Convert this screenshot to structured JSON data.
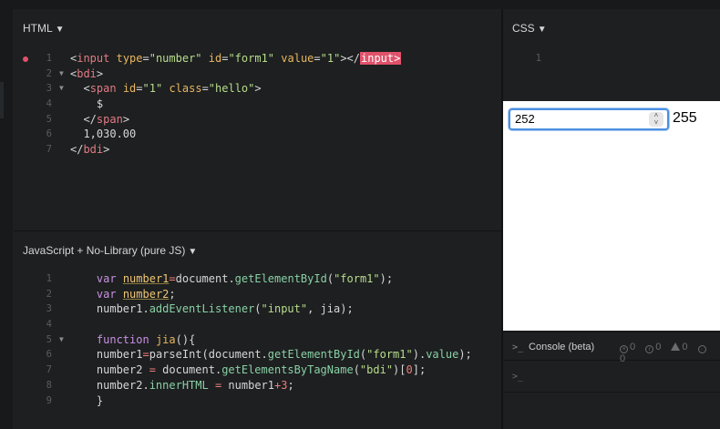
{
  "html_panel": {
    "title": "HTML",
    "lines": [
      {
        "n": "1",
        "error": true,
        "fold": false,
        "indent": "",
        "tokens": [
          {
            "t": "<",
            "c": "c-plain"
          },
          {
            "t": "input",
            "c": "c-tag"
          },
          {
            "t": " ",
            "c": "c-plain"
          },
          {
            "t": "type",
            "c": "c-attr"
          },
          {
            "t": "=",
            "c": "c-plain"
          },
          {
            "t": "\"number\"",
            "c": "c-str"
          },
          {
            "t": " ",
            "c": "c-plain"
          },
          {
            "t": "id",
            "c": "c-attr"
          },
          {
            "t": "=",
            "c": "c-plain"
          },
          {
            "t": "\"form1\"",
            "c": "c-str"
          },
          {
            "t": " ",
            "c": "c-plain"
          },
          {
            "t": "value",
            "c": "c-attr"
          },
          {
            "t": "=",
            "c": "c-plain"
          },
          {
            "t": "\"1\"",
            "c": "c-str"
          },
          {
            "t": "></",
            "c": "c-plain"
          },
          {
            "t": "input>",
            "c": "c-hl"
          }
        ]
      },
      {
        "n": "2",
        "error": false,
        "fold": true,
        "indent": "",
        "tokens": [
          {
            "t": "<",
            "c": "c-plain"
          },
          {
            "t": "bdi",
            "c": "c-tag"
          },
          {
            "t": ">",
            "c": "c-plain"
          }
        ]
      },
      {
        "n": "3",
        "error": false,
        "fold": true,
        "indent": "  ",
        "tokens": [
          {
            "t": "<",
            "c": "c-plain"
          },
          {
            "t": "span",
            "c": "c-tag"
          },
          {
            "t": " ",
            "c": "c-plain"
          },
          {
            "t": "id",
            "c": "c-attr"
          },
          {
            "t": "=",
            "c": "c-plain"
          },
          {
            "t": "\"1\"",
            "c": "c-str"
          },
          {
            "t": " ",
            "c": "c-plain"
          },
          {
            "t": "class",
            "c": "c-attr"
          },
          {
            "t": "=",
            "c": "c-plain"
          },
          {
            "t": "\"hello\"",
            "c": "c-str"
          },
          {
            "t": ">",
            "c": "c-plain"
          }
        ]
      },
      {
        "n": "4",
        "error": false,
        "fold": false,
        "indent": "    ",
        "tokens": [
          {
            "t": "$",
            "c": "c-plain"
          }
        ]
      },
      {
        "n": "5",
        "error": false,
        "fold": false,
        "indent": "  ",
        "tokens": [
          {
            "t": "</",
            "c": "c-plain"
          },
          {
            "t": "span",
            "c": "c-tag"
          },
          {
            "t": ">",
            "c": "c-plain"
          }
        ]
      },
      {
        "n": "6",
        "error": false,
        "fold": false,
        "indent": "  ",
        "tokens": [
          {
            "t": "1,030.00",
            "c": "c-plain"
          }
        ]
      },
      {
        "n": "7",
        "error": false,
        "fold": false,
        "indent": "",
        "tokens": [
          {
            "t": "</",
            "c": "c-plain"
          },
          {
            "t": "bdi",
            "c": "c-tag"
          },
          {
            "t": ">",
            "c": "c-plain"
          }
        ]
      }
    ]
  },
  "css_panel": {
    "title": "CSS",
    "lines": [
      {
        "n": "1",
        "error": false,
        "fold": false,
        "indent": "",
        "tokens": []
      }
    ]
  },
  "js_panel": {
    "title": "JavaScript + No-Library (pure JS)",
    "lines": [
      {
        "n": "1",
        "fold": false,
        "indent": "    ",
        "tokens": [
          {
            "t": "var",
            "c": "c-kw"
          },
          {
            "t": " ",
            "c": "c-plain"
          },
          {
            "t": "number1",
            "c": "c-var"
          },
          {
            "t": "=",
            "c": "c-op"
          },
          {
            "t": "document.",
            "c": "c-plain"
          },
          {
            "t": "getElementById",
            "c": "c-fn"
          },
          {
            "t": "(",
            "c": "c-plain"
          },
          {
            "t": "\"form1\"",
            "c": "c-str"
          },
          {
            "t": ");",
            "c": "c-plain"
          }
        ]
      },
      {
        "n": "2",
        "fold": false,
        "indent": "    ",
        "tokens": [
          {
            "t": "var",
            "c": "c-kw"
          },
          {
            "t": " ",
            "c": "c-plain"
          },
          {
            "t": "number2",
            "c": "c-var"
          },
          {
            "t": ";",
            "c": "c-plain"
          }
        ]
      },
      {
        "n": "3",
        "fold": false,
        "indent": "    ",
        "tokens": [
          {
            "t": "number1.",
            "c": "c-plain"
          },
          {
            "t": "addEventListener",
            "c": "c-fn"
          },
          {
            "t": "(",
            "c": "c-plain"
          },
          {
            "t": "\"input\"",
            "c": "c-str"
          },
          {
            "t": ", jia);",
            "c": "c-plain"
          }
        ]
      },
      {
        "n": "4",
        "fold": false,
        "indent": "",
        "tokens": []
      },
      {
        "n": "5",
        "fold": true,
        "indent": "    ",
        "tokens": [
          {
            "t": "function",
            "c": "c-kw"
          },
          {
            "t": " ",
            "c": "c-plain"
          },
          {
            "t": "jia",
            "c": "c-attr"
          },
          {
            "t": "(){",
            "c": "c-plain"
          }
        ]
      },
      {
        "n": "6",
        "fold": false,
        "indent": "    ",
        "tokens": [
          {
            "t": "number1",
            "c": "c-plain"
          },
          {
            "t": "=",
            "c": "c-op"
          },
          {
            "t": "parseInt(document.",
            "c": "c-plain"
          },
          {
            "t": "getElementById",
            "c": "c-fn"
          },
          {
            "t": "(",
            "c": "c-plain"
          },
          {
            "t": "\"form1\"",
            "c": "c-str"
          },
          {
            "t": ").",
            "c": "c-plain"
          },
          {
            "t": "value",
            "c": "c-prop"
          },
          {
            "t": ");",
            "c": "c-plain"
          }
        ]
      },
      {
        "n": "7",
        "fold": false,
        "indent": "    ",
        "tokens": [
          {
            "t": "number2 ",
            "c": "c-plain"
          },
          {
            "t": "=",
            "c": "c-op"
          },
          {
            "t": " document.",
            "c": "c-plain"
          },
          {
            "t": "getElementsByTagName",
            "c": "c-fn"
          },
          {
            "t": "(",
            "c": "c-plain"
          },
          {
            "t": "\"bdi\"",
            "c": "c-str"
          },
          {
            "t": ")[",
            "c": "c-plain"
          },
          {
            "t": "0",
            "c": "c-num"
          },
          {
            "t": "];",
            "c": "c-plain"
          }
        ]
      },
      {
        "n": "8",
        "fold": false,
        "indent": "    ",
        "tokens": [
          {
            "t": "number2.",
            "c": "c-plain"
          },
          {
            "t": "innerHTML",
            "c": "c-prop"
          },
          {
            "t": " ",
            "c": "c-plain"
          },
          {
            "t": "=",
            "c": "c-op"
          },
          {
            "t": " number1",
            "c": "c-plain"
          },
          {
            "t": "+",
            "c": "c-op"
          },
          {
            "t": "3",
            "c": "c-num"
          },
          {
            "t": ";",
            "c": "c-plain"
          }
        ]
      },
      {
        "n": "9",
        "fold": false,
        "indent": "    ",
        "tokens": [
          {
            "t": "}",
            "c": "c-plain"
          }
        ]
      }
    ]
  },
  "preview": {
    "input_value": "252",
    "bdi_text": "255"
  },
  "console": {
    "title": "Console (beta)",
    "prompt": ">_",
    "errors": "0",
    "info": "0",
    "warnings": "0",
    "logs": "0",
    "input_prompt": ">_"
  },
  "colors": {
    "accent": "#4a90e2",
    "error": "#e0526a",
    "bg": "#1d1f20"
  }
}
